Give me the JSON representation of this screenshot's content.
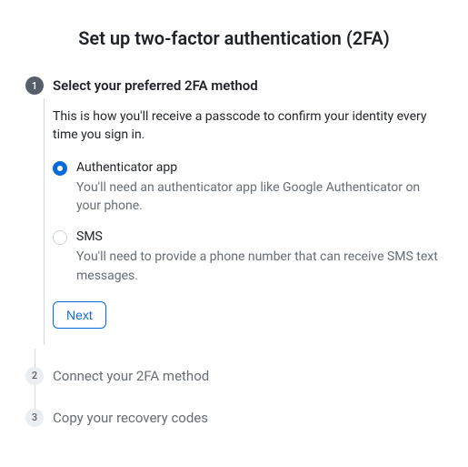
{
  "title": "Set up two-factor authentication (2FA)",
  "steps": [
    {
      "number": "1",
      "title": "Select your preferred 2FA method",
      "description": "This is how you'll receive a passcode to confirm your identity every time you sign in.",
      "options": [
        {
          "label": "Authenticator app",
          "description": "You'll need an authenticator app like Google Authenticator on your phone."
        },
        {
          "label": "SMS",
          "description": "You'll need to provide a phone number that can receive SMS text messages."
        }
      ],
      "next_label": "Next"
    },
    {
      "number": "2",
      "title": "Connect your 2FA method"
    },
    {
      "number": "3",
      "title": "Copy your recovery codes"
    }
  ]
}
